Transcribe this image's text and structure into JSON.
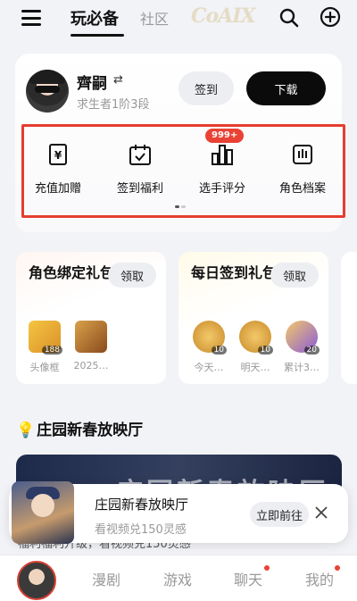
{
  "header": {
    "tabs": [
      {
        "label": "玩必备",
        "active": true
      },
      {
        "label": "社区",
        "active": false
      }
    ],
    "logo_text": "CoAIX"
  },
  "profile": {
    "username": "齊嗣",
    "swap_symbol": "⇄",
    "rank": "求生者1阶3段",
    "checkin_label": "签到",
    "download_label": "下载"
  },
  "features": {
    "badge": "999+",
    "items": [
      {
        "label": "充值加赠",
        "icon": "yen-voucher-icon"
      },
      {
        "label": "签到福利",
        "icon": "calendar-check-icon"
      },
      {
        "label": "选手评分",
        "icon": "bar-chart-icon"
      },
      {
        "label": "角色档案",
        "icon": "profile-archive-icon"
      }
    ]
  },
  "gift_cards": [
    {
      "title": "角色绑定礼包",
      "claim_label": "领取",
      "items": [
        {
          "name": "头像框",
          "qty": "188"
        },
        {
          "name": "2025…",
          "qty": ""
        }
      ]
    },
    {
      "title": "每日签到礼包",
      "claim_label": "领取",
      "items": [
        {
          "name": "今天…",
          "qty": "10"
        },
        {
          "name": "明天…",
          "qty": "10"
        },
        {
          "name": "累计3…",
          "qty": "20"
        }
      ]
    }
  ],
  "section": {
    "title": "庄园新春放映厅",
    "banner_text": "庄园新春放映厅",
    "under_text": "福利福利升级，看视频兑150灵感"
  },
  "popup": {
    "title": "庄园新春放映厅",
    "subtitle": "看视频兑150灵感",
    "action_label": "立即前往"
  },
  "bottom_nav": {
    "items": [
      {
        "label": "漫剧",
        "dot": false
      },
      {
        "label": "游戏",
        "dot": false
      },
      {
        "label": "聊天",
        "dot": true
      },
      {
        "label": "我的",
        "dot": true
      }
    ]
  },
  "colors": {
    "accent_red": "#e94235",
    "highlight_border": "#e53d2f",
    "background": "#f2f3f7",
    "button_dark": "#0b0b0b"
  }
}
